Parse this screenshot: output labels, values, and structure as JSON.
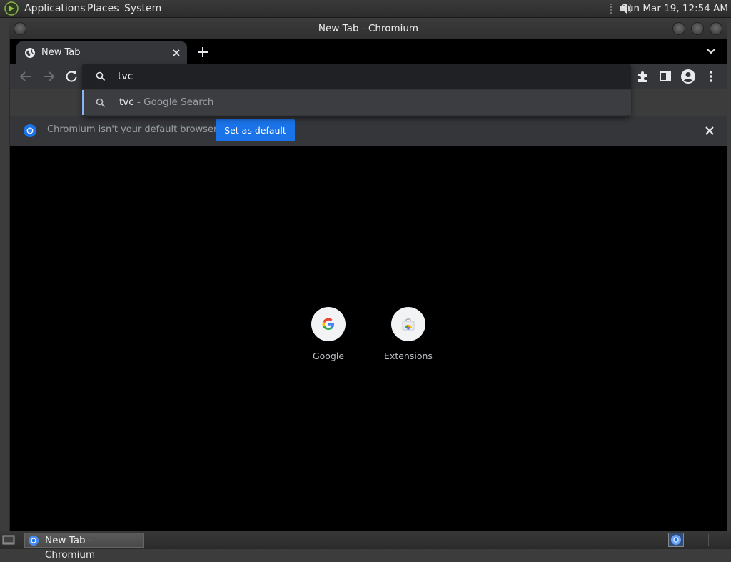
{
  "top_panel": {
    "menus": [
      "Applications",
      "Places",
      "System"
    ],
    "clock": "Sun Mar 19, 12:54 AM"
  },
  "window": {
    "title": "New Tab - Chromium"
  },
  "tabs": [
    {
      "title": "New Tab",
      "favicon": "globe-icon",
      "active": true
    }
  ],
  "omnibox": {
    "value": "tvc",
    "suggestion": {
      "query": "tvc",
      "description": " - Google Search",
      "icon": "search-icon"
    }
  },
  "infobar": {
    "message": "Chromium isn't your default browser",
    "button_label": "Set as default"
  },
  "shortcuts": [
    {
      "label": "Google",
      "icon": "google-icon"
    },
    {
      "label": "Extensions",
      "icon": "chrome-web-store-icon"
    }
  ],
  "taskbar": {
    "task_label": "New Tab - Chromium"
  },
  "colors": {
    "accent": "#1a73e8",
    "suggestion_highlight": "#8ab4f8",
    "toolbar": "#35363a",
    "page_background": "#000000"
  }
}
